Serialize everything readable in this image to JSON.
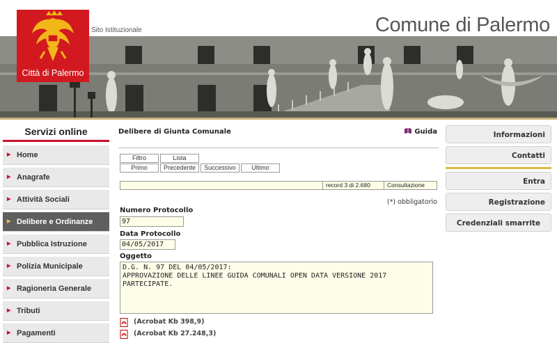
{
  "header": {
    "logo_caption": "Città di Palermo",
    "site_label": "Sito Istituzionale",
    "title": "Comune di Palermo"
  },
  "sidebar": {
    "title": "Servizi online",
    "items": [
      {
        "label": "Home",
        "active": false
      },
      {
        "label": "Anagrafe",
        "active": false
      },
      {
        "label": "Attività Sociali",
        "active": false
      },
      {
        "label": "Delibere e Ordinanze",
        "active": true
      },
      {
        "label": "Pubblica Istruzione",
        "active": false
      },
      {
        "label": "Polizia Municipale",
        "active": false
      },
      {
        "label": "Ragioneria Generale",
        "active": false
      },
      {
        "label": "Tributi",
        "active": false
      },
      {
        "label": "Pagamenti",
        "active": false
      }
    ]
  },
  "main": {
    "page_title": "Delibere di Giunta Comunale",
    "help_label": "Guida",
    "toolbar": {
      "filtro": "Filtro",
      "lista": "Lista",
      "primo": "Primo",
      "precedente": "Precedente",
      "successivo": "Successivo",
      "ultimo": "Ultimo"
    },
    "status": {
      "record": "record 3 di 2.680",
      "mode": "Consultazione"
    },
    "required_note": "(*) obbligatorio",
    "fields": {
      "numero_label": "Numero Protocollo",
      "numero_value": "97",
      "data_label": "Data Protocollo",
      "data_value": "04/05/2017",
      "oggetto_label": "Oggetto",
      "oggetto_value": "D.G. N. 97 DEL 04/05/2017:\nAPPROVAZIONE DELLE LINEE GUIDA COMUNALI OPEN DATA VERSIONE 2017\nPARTECIPATE."
    },
    "attachments": [
      {
        "label": "(Acrobat Kb 398,9)"
      },
      {
        "label": "(Acrobat Kb 27.248,3)"
      }
    ]
  },
  "right_panel": {
    "informazioni": "Informazioni",
    "contatti": "Contatti",
    "entra": "Entra",
    "registrazione": "Registrazione",
    "credenziali": "Credenziali smarrite"
  },
  "colors": {
    "brand_red": "#d21920",
    "nav_active": "#5f5f5f",
    "field_bg": "#fdfde8",
    "accent_gold": "#d8b94a"
  },
  "icons": [
    "palermo-eagle-crest-icon",
    "book-icon",
    "pdf-icon",
    "arrow-right-icon"
  ]
}
